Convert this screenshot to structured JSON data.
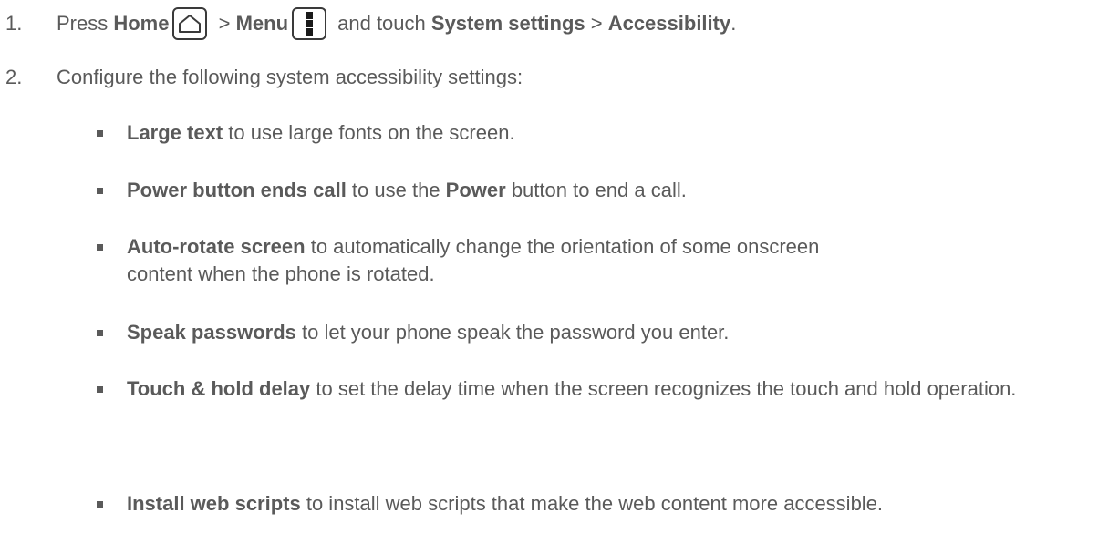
{
  "step1": {
    "num": "1.",
    "t1": "Press ",
    "home": "Home",
    "home_icon": "home-key-icon",
    "sep1": " > ",
    "menu": "Menu",
    "menu_icon": "menu-key-icon",
    "t2": " and touch ",
    "sys": "System settings",
    "sep2": " > ",
    "acc": "Accessibility",
    "t3": "."
  },
  "step2": {
    "num": "2.",
    "text": "Configure the following system accessibility settings:"
  },
  "bullets": [
    {
      "bold": "Large text",
      "rest": " to use large fonts on the screen."
    },
    {
      "bold": "Power button ends call",
      "mid": " to use the ",
      "bold2": "Power",
      "rest": " button to end a call."
    },
    {
      "bold": "Auto-rotate screen",
      "rest": " to automatically change the orientation of some onscreen content when the phone is rotated."
    },
    {
      "bold": "Speak passwords",
      "rest": " to let your phone speak the password you enter."
    },
    {
      "bold": "Touch & hold delay",
      "rest": " to set the delay time when the screen recognizes the touch and hold operation."
    },
    {
      "bold": "Install web scripts",
      "rest": " to install web scripts that make the web content more accessible."
    }
  ]
}
